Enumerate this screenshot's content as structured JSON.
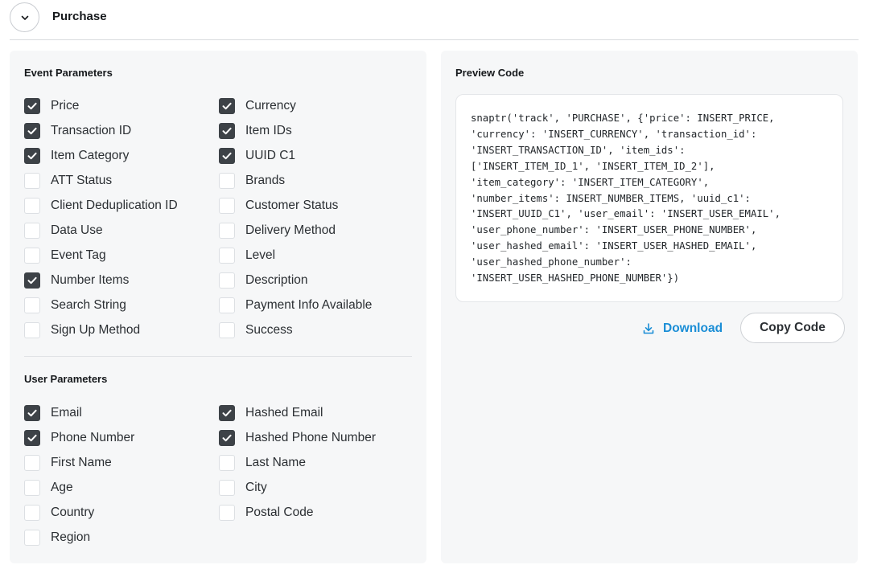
{
  "header": {
    "title": "Purchase",
    "collapse_icon": "chevron-down-icon"
  },
  "event_parameters": {
    "title": "Event Parameters",
    "left": [
      {
        "label": "Price",
        "checked": true
      },
      {
        "label": "Transaction ID",
        "checked": true
      },
      {
        "label": "Item Category",
        "checked": true
      },
      {
        "label": "ATT Status",
        "checked": false
      },
      {
        "label": "Client Deduplication ID",
        "checked": false
      },
      {
        "label": "Data Use",
        "checked": false
      },
      {
        "label": "Event Tag",
        "checked": false
      },
      {
        "label": "Number Items",
        "checked": true
      },
      {
        "label": "Search String",
        "checked": false
      },
      {
        "label": "Sign Up Method",
        "checked": false
      }
    ],
    "right": [
      {
        "label": "Currency",
        "checked": true
      },
      {
        "label": "Item IDs",
        "checked": true
      },
      {
        "label": "UUID C1",
        "checked": true
      },
      {
        "label": "Brands",
        "checked": false
      },
      {
        "label": "Customer Status",
        "checked": false
      },
      {
        "label": "Delivery Method",
        "checked": false
      },
      {
        "label": "Level",
        "checked": false
      },
      {
        "label": "Description",
        "checked": false
      },
      {
        "label": "Payment Info Available",
        "checked": false
      },
      {
        "label": "Success",
        "checked": false
      }
    ]
  },
  "user_parameters": {
    "title": "User Parameters",
    "left": [
      {
        "label": "Email",
        "checked": true
      },
      {
        "label": "Phone Number",
        "checked": true
      },
      {
        "label": "First Name",
        "checked": false
      },
      {
        "label": "Age",
        "checked": false
      },
      {
        "label": "Country",
        "checked": false
      },
      {
        "label": "Region",
        "checked": false
      }
    ],
    "right": [
      {
        "label": "Hashed Email",
        "checked": true
      },
      {
        "label": "Hashed Phone Number",
        "checked": true
      },
      {
        "label": "Last Name",
        "checked": false
      },
      {
        "label": "City",
        "checked": false
      },
      {
        "label": "Postal Code",
        "checked": false
      }
    ]
  },
  "preview": {
    "title": "Preview Code",
    "code_lines": [
      "snaptr('track', 'PURCHASE', {'price': INSERT_PRICE,",
      "'currency': 'INSERT_CURRENCY', 'transaction_id':",
      "'INSERT_TRANSACTION_ID', 'item_ids':",
      "['INSERT_ITEM_ID_1', 'INSERT_ITEM_ID_2'],",
      "'item_category': 'INSERT_ITEM_CATEGORY',",
      "'number_items': INSERT_NUMBER_ITEMS, 'uuid_c1':",
      "'INSERT_UUID_C1', 'user_email': 'INSERT_USER_EMAIL',",
      "'user_phone_number': 'INSERT_USER_PHONE_NUMBER',",
      "'user_hashed_email': 'INSERT_USER_HASHED_EMAIL',",
      "'user_hashed_phone_number':",
      "'INSERT_USER_HASHED_PHONE_NUMBER'})"
    ],
    "download_label": "Download",
    "download_icon": "download-icon",
    "copy_label": "Copy Code"
  },
  "colors": {
    "accent": "#1b8ed6",
    "checkbox_checked": "#3d4247",
    "panel_bg": "#f6f7f8"
  }
}
